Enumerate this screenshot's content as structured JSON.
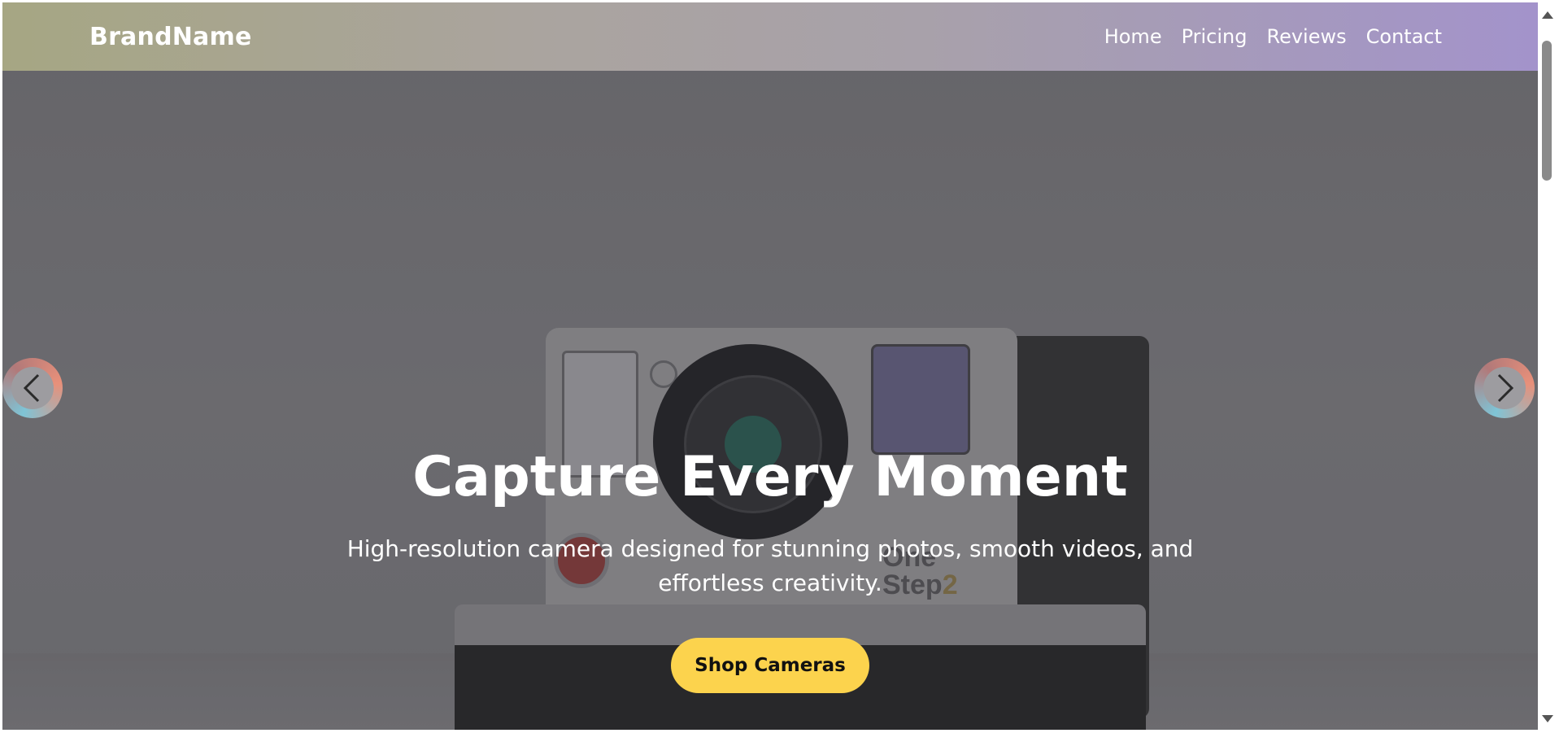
{
  "nav": {
    "brand": "BrandName",
    "links": [
      "Home",
      "Pricing",
      "Reviews",
      "Contact"
    ]
  },
  "hero": {
    "title": "Capture Every Moment",
    "subtitle": "High-resolution camera designed for stunning photos, smooth videos, and effortless creativity.",
    "cta_label": "Shop Cameras",
    "camera_text_one": "One",
    "camera_text_step": "Step",
    "camera_text_two": "2"
  },
  "carousel": {
    "prev_icon": "chevron-left-icon",
    "next_icon": "chevron-right-icon"
  },
  "colors": {
    "accent": "#fcd34d",
    "nav_gradient_start": "#a6a683",
    "nav_gradient_end": "#a393cb"
  }
}
